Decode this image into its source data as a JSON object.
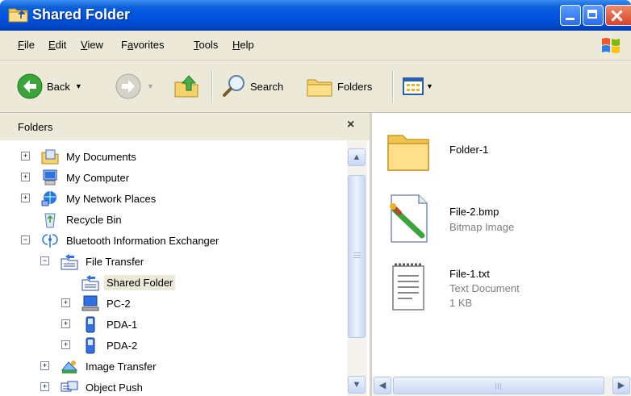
{
  "window": {
    "title": "Shared Folder"
  },
  "menu": [
    "File",
    "Edit",
    "View",
    "Favorites",
    "Tools",
    "Help"
  ],
  "menu_underline": [
    "F",
    "E",
    "V",
    "a",
    "T",
    "H"
  ],
  "toolbar": {
    "back_label": "Back",
    "search_label": "Search",
    "folders_label": "Folders"
  },
  "folders_pane": {
    "title": "Folders",
    "close_symbol": "×",
    "tree": [
      {
        "label": "My Documents",
        "icon": "my-documents-icon",
        "expander": "+"
      },
      {
        "label": "My Computer",
        "icon": "my-computer-icon",
        "expander": "+"
      },
      {
        "label": "My Network Places",
        "icon": "network-places-icon",
        "expander": "+"
      },
      {
        "label": "Recycle Bin",
        "icon": "recycle-bin-icon",
        "expander": ""
      },
      {
        "label": "Bluetooth Information Exchanger",
        "icon": "bluetooth-icon",
        "expander": "−"
      },
      {
        "label": "File Transfer",
        "icon": "file-transfer-icon",
        "expander": "−"
      },
      {
        "label": "Shared Folder",
        "icon": "shared-folder-icon",
        "expander": "",
        "selected": true
      },
      {
        "label": "PC-2",
        "icon": "pc-icon",
        "expander": "+"
      },
      {
        "label": "PDA-1",
        "icon": "pda-icon",
        "expander": "+"
      },
      {
        "label": "PDA-2",
        "icon": "pda-icon",
        "expander": "+"
      },
      {
        "label": "Image Transfer",
        "icon": "image-transfer-icon",
        "expander": "+"
      },
      {
        "label": "Object Push",
        "icon": "object-push-icon",
        "expander": "+"
      }
    ]
  },
  "files": [
    {
      "name": "Folder-1",
      "type": "",
      "size": "",
      "icon": "folder-icon"
    },
    {
      "name": "File-2.bmp",
      "type": "Bitmap Image",
      "size": "",
      "icon": "bitmap-icon"
    },
    {
      "name": "File-1.txt",
      "type": "Text Document",
      "size": "1 KB",
      "icon": "text-document-icon"
    }
  ],
  "colors": {
    "titlebar": "#0054e3",
    "chrome": "#ece9d8",
    "selection": "#ece9d8",
    "meta_text": "#7d7d7d"
  }
}
